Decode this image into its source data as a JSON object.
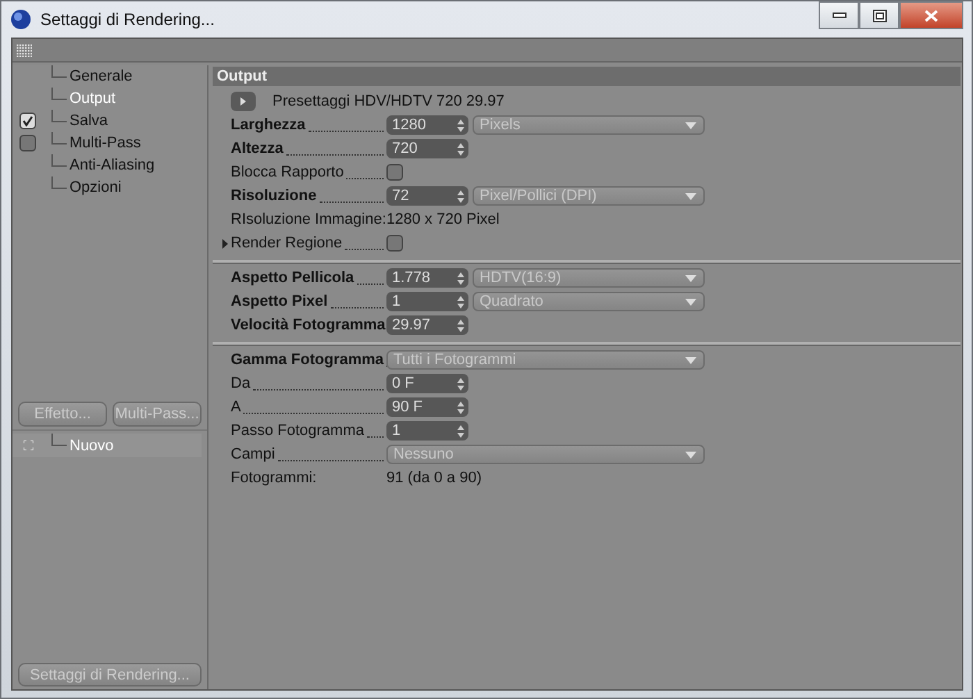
{
  "window": {
    "title": "Settaggi di Rendering..."
  },
  "sidebar": {
    "items": [
      {
        "label": "Generale",
        "kind": "plain",
        "selected": false
      },
      {
        "label": "Output",
        "kind": "plain",
        "selected": true
      },
      {
        "label": "Salva",
        "kind": "checkbox",
        "checked": true,
        "selected": false
      },
      {
        "label": "Multi-Pass",
        "kind": "checkbox",
        "checked": false,
        "selected": false
      },
      {
        "label": "Anti-Aliasing",
        "kind": "plain",
        "selected": false
      },
      {
        "label": "Opzioni",
        "kind": "plain",
        "selected": false
      }
    ],
    "buttons": [
      "Effetto...",
      "Multi-Pass..."
    ],
    "effects": [
      {
        "label": "Nuovo"
      }
    ],
    "bottom_button": "Settaggi di Rendering..."
  },
  "panel": {
    "title": "Output",
    "sections": [
      [
        {
          "kind": "preset",
          "label": "Presettaggi HDV/HDTV 720 29.97"
        },
        {
          "kind": "number",
          "label": "Larghezza",
          "bold": true,
          "value": "1280",
          "dropdown": "Pixels"
        },
        {
          "kind": "number",
          "label": "Altezza",
          "bold": true,
          "value": "720"
        },
        {
          "kind": "checkbox",
          "label": "Blocca Rapporto",
          "bold": false,
          "checked": false
        },
        {
          "kind": "number",
          "label": "Risoluzione",
          "bold": true,
          "value": "72",
          "dropdown": "Pixel/Pollici (DPI)"
        },
        {
          "kind": "info",
          "label": "RIsoluzione Immagine:",
          "value": "1280 x 720 Pixel"
        },
        {
          "kind": "checkbox",
          "label": "Render Regione",
          "bold": false,
          "checked": false,
          "arrow": true
        }
      ],
      [
        {
          "kind": "number",
          "label": "Aspetto Pellicola",
          "bold": true,
          "value": "1.778",
          "dropdown": "HDTV(16:9)"
        },
        {
          "kind": "number",
          "label": "Aspetto Pixel",
          "bold": true,
          "value": "1",
          "dropdown": "Quadrato"
        },
        {
          "kind": "number",
          "label": "Velocità Fotogramma",
          "bold": true,
          "value": "29.97"
        }
      ],
      [
        {
          "kind": "select",
          "label": "Gamma Fotogramma",
          "bold": true,
          "dropdown": "Tutti i Fotogrammi"
        },
        {
          "kind": "number",
          "label": "Da",
          "bold": false,
          "value": "0 F"
        },
        {
          "kind": "number",
          "label": "A",
          "bold": false,
          "value": "90 F"
        },
        {
          "kind": "number",
          "label": "Passo Fotogramma",
          "bold": false,
          "value": "1"
        },
        {
          "kind": "select",
          "label": "Campi",
          "bold": false,
          "dropdown": "Nessuno"
        },
        {
          "kind": "info",
          "label": "Fotogrammi:",
          "value": "91 (da 0 a 90)"
        }
      ]
    ]
  }
}
